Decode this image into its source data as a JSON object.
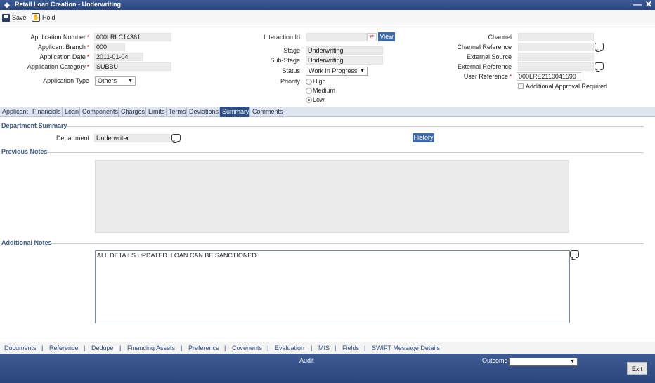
{
  "window": {
    "title": "Retail Loan Creation - Underwriting",
    "minimize": "—",
    "close": "✕"
  },
  "toolbar": {
    "save_label": "Save",
    "hold_label": "Hold"
  },
  "header_left": {
    "application_number": {
      "label": "Application Number",
      "value": "000LRLC14361"
    },
    "applicant_branch": {
      "label": "Applicant Branch",
      "value": "000"
    },
    "application_date": {
      "label": "Application Date",
      "value": "2011-01-04"
    },
    "application_category": {
      "label": "Application Category",
      "value": "SUBBU"
    },
    "application_type": {
      "label": "Application Type",
      "value": "Others"
    }
  },
  "header_mid": {
    "interaction_id": {
      "label": "Interaction Id",
      "value": "",
      "view_label": "View"
    },
    "stage": {
      "label": "Stage",
      "value": "Underwriting"
    },
    "sub_stage": {
      "label": "Sub-Stage",
      "value": "Underwriting"
    },
    "status": {
      "label": "Status",
      "value": "Work In Progress"
    },
    "priority": {
      "label": "Priority",
      "options": [
        "High",
        "Medium",
        "Low"
      ],
      "selected": "Low"
    }
  },
  "header_right": {
    "channel": {
      "label": "Channel",
      "value": ""
    },
    "channel_reference": {
      "label": "Channel Reference",
      "value": ""
    },
    "external_source": {
      "label": "External Source",
      "value": ""
    },
    "external_reference": {
      "label": "External Reference",
      "value": ""
    },
    "user_reference": {
      "label": "User Reference",
      "value": "000LRE2110041590"
    },
    "additional_approval": {
      "label": "Additional Approval Required",
      "checked": false
    }
  },
  "tabs": [
    "Applicant",
    "Financials",
    "Loan",
    "Components",
    "Charges",
    "Limits",
    "Terms",
    "Deviations",
    "Summary",
    "Comments"
  ],
  "active_tab": "Summary",
  "department_summary": {
    "title": "Department Summary",
    "department_label": "Department",
    "department_value": "Underwriter",
    "history_label": "History"
  },
  "previous_notes": {
    "title": "Previous Notes",
    "text": ""
  },
  "additional_notes": {
    "title": "Additional Notes",
    "text": "ALL DETAILS UPDATED. LOAN CAN BE SANCTIONED."
  },
  "bottom_nav": [
    "Documents",
    "Reference",
    "Dedupe",
    "Financing Assets",
    "Preference",
    "Covenents",
    "Evaluation",
    "MIS",
    "Fields",
    "SWIFT Message Details"
  ],
  "bottom_sep": "|",
  "footer": {
    "audit_label": "Audit",
    "outcome_label": "Outcome",
    "outcome_value": "",
    "exit_label": "Exit"
  },
  "required_mark": "*",
  "colors": {
    "title_bar": "#2a4680",
    "active_tab": "#2c4d83",
    "link": "#2d4c87",
    "required": "#cc0000"
  }
}
